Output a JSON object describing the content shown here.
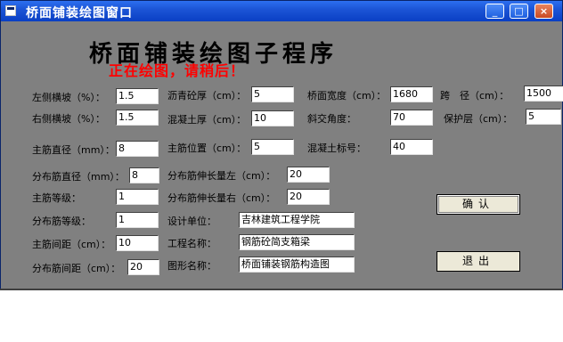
{
  "window": {
    "title": "桥面铺装绘图窗口"
  },
  "heading": {
    "title": "桥面铺装绘图子程序",
    "status": "正在绘图，请稍后！"
  },
  "fields": {
    "left_slope": {
      "label": "左侧横坡（%）：",
      "value": "1.5"
    },
    "right_slope": {
      "label": "右侧横坡（%）：",
      "value": "1.5"
    },
    "main_diameter": {
      "label": "主筋直径（mm）：",
      "value": "8"
    },
    "dist_diameter": {
      "label": "分布筋直径（mm）：",
      "value": "8"
    },
    "main_grade": {
      "label": "主筋等级：",
      "value": "1"
    },
    "dist_grade": {
      "label": "分布筋等级：",
      "value": "1"
    },
    "main_spacing": {
      "label": "主筋间距（cm）：",
      "value": "10"
    },
    "dist_spacing": {
      "label": "分布筋间距（cm）：",
      "value": "20"
    },
    "asphalt_thick": {
      "label": "沥青砼厚（cm）：",
      "value": "5"
    },
    "concrete_thick": {
      "label": "混凝土厚（cm）：",
      "value": "10"
    },
    "main_position": {
      "label": "主筋位置（cm）：",
      "value": "5"
    },
    "dist_ext_left": {
      "label": "分布筋伸长量左（cm）：",
      "value": "20"
    },
    "dist_ext_right": {
      "label": "分布筋伸长量右（cm）：",
      "value": "20"
    },
    "design_unit": {
      "label": "设计单位：",
      "value": "吉林建筑工程学院"
    },
    "project_name": {
      "label": "工程名称：",
      "value": "钢筋砼简支箱梁"
    },
    "drawing_name": {
      "label": "图形名称：",
      "value": "桥面铺装钢筋构造图"
    },
    "bridge_width": {
      "label": "桥面宽度（cm）：",
      "value": "1680"
    },
    "skew_angle": {
      "label": "斜交角度：",
      "value": "70"
    },
    "concrete_grade": {
      "label": "混凝土标号：",
      "value": "40"
    },
    "span": {
      "label": "跨　径（cm）：",
      "value": "1500"
    },
    "cover": {
      "label": "保护层（cm）：",
      "value": "5"
    }
  },
  "buttons": {
    "confirm": "确认",
    "exit": "退出"
  },
  "titlebar": {
    "minimize": "_",
    "maximize": "□",
    "close": "×"
  },
  "colors": {
    "titlebar": "#0a3fc4",
    "client": "#808080",
    "status_text": "#ff0000"
  }
}
